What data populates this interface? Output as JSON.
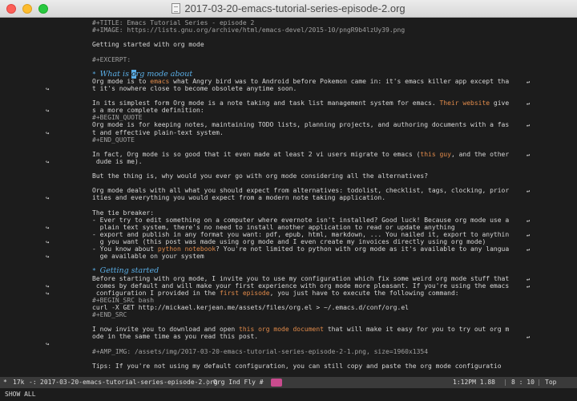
{
  "window": {
    "title": "2017-03-20-emacs-tutorial-series-episode-2.org"
  },
  "lines": [
    [
      {
        "t": "#+TITLE: Emacs Tutorial Series - episode 2",
        "c": "meta"
      }
    ],
    [
      {
        "t": "#+IMAGE: https://lists.gnu.org/archive/html/emacs-devel/2015-10/pngR9b4lzUy39.png",
        "c": "meta"
      }
    ],
    [],
    [
      {
        "t": "Getting started with org mode"
      }
    ],
    [],
    [
      {
        "t": "#+EXCERPT:",
        "c": "meta"
      }
    ],
    [],
    [
      {
        "t": "* ",
        "c": "bullet"
      },
      {
        "t": "What is ",
        "c": "heading"
      },
      {
        "t": "o",
        "c": "heading cursor"
      },
      {
        "t": "rg mode about",
        "c": "heading"
      }
    ],
    [
      {
        "t": "Org mode is to "
      },
      {
        "t": "emacs",
        "c": "link"
      },
      {
        "t": " what Angry bird was to Android before Pokemon came in: it's emacs killer app except tha"
      }
    ],
    [
      {
        "t": "t it's nowhere close to become obsolete anytime soon."
      }
    ],
    [],
    [
      {
        "t": "In its simplest form Org mode is a note taking and task list management system for emacs. "
      },
      {
        "t": "Their website",
        "c": "link"
      },
      {
        "t": " give"
      }
    ],
    [
      {
        "t": "s a more complete definition:"
      }
    ],
    [
      {
        "t": "#+BEGIN_QUOTE",
        "c": "meta"
      }
    ],
    [
      {
        "t": "Org mode is for keeping notes, maintaining TODO lists, planning projects, and authoring documents with a fas"
      }
    ],
    [
      {
        "t": "t and effective plain-text system."
      }
    ],
    [
      {
        "t": "#+END_QUOTE",
        "c": "meta"
      }
    ],
    [],
    [
      {
        "t": "In fact, Org mode is so good that it even made at least 2 vi users migrate to emacs ("
      },
      {
        "t": "this guy",
        "c": "link"
      },
      {
        "t": ", and the other"
      }
    ],
    [
      {
        "t": " dude is me)."
      }
    ],
    [],
    [
      {
        "t": "But the thing is, why would you ever go with org mode considering all the alternatives?"
      }
    ],
    [],
    [
      {
        "t": "Org mode deals with all what you should expect from alternatives: todolist, checklist, tags, clocking, prior"
      }
    ],
    [
      {
        "t": "ities and everything you would expect from a modern note taking application."
      }
    ],
    [],
    [
      {
        "t": "The tie breaker:"
      }
    ],
    [
      {
        "t": "- Ever try to edit something on a computer where evernote isn't installed? Good luck! Because org mode use a"
      }
    ],
    [
      {
        "t": "  plain text system, there's no need to install another application to read or update anything"
      }
    ],
    [
      {
        "t": "- export and publish in any format you want: pdf, epub, html, markdown, ... You nailed it, export to anythin"
      }
    ],
    [
      {
        "t": "  g you want (this post was made using org mode and I even create my invoices directly using org mode)"
      }
    ],
    [
      {
        "t": "- You know about "
      },
      {
        "t": "python notebook",
        "c": "link"
      },
      {
        "t": "? You're not limited to python with org mode as it's available to any langua"
      }
    ],
    [
      {
        "t": "  ge available on your system"
      }
    ],
    [],
    [
      {
        "t": "* ",
        "c": "bullet"
      },
      {
        "t": "Getting started",
        "c": "heading"
      }
    ],
    [
      {
        "t": "Before starting with org mode, I invite you to use my configuration which fix some weird org mode stuff that"
      }
    ],
    [
      {
        "t": " comes by default and will make your first experience with org mode more pleasant. If you're using the emacs"
      }
    ],
    [
      {
        "t": " configuration I provided in the "
      },
      {
        "t": "first episode",
        "c": "link"
      },
      {
        "t": ", you just have to execute the following command:"
      }
    ],
    [
      {
        "t": "#+BEGIN_SRC bash",
        "c": "meta"
      }
    ],
    [
      {
        "t": "curl -X GET http://mickael.kerjean.me/assets/files/org.el > ~/.emacs.d/conf/org.el"
      }
    ],
    [
      {
        "t": "#+END_SRC",
        "c": "meta"
      }
    ],
    [],
    [
      {
        "t": "I now invite you to download and open "
      },
      {
        "t": "this org mode document",
        "c": "link"
      },
      {
        "t": " that will make it easy for you to try out org m"
      }
    ],
    [
      {
        "t": "ode in the same time as you read this post."
      }
    ],
    [],
    [
      {
        "t": "#+AMP_IMG: /assets/img/2017-03-20-emacs-tutorial-series-episode-2-1.png, size=1960x1354",
        "c": "meta"
      }
    ],
    [],
    [
      {
        "t": "Tips: If you're not using my default configuration, you can still copy and paste the org mode configuratio"
      }
    ]
  ],
  "wrap_markers": [
    8,
    11,
    14,
    18,
    23,
    27,
    29,
    31,
    35,
    36,
    43
  ],
  "cont_markers": [
    9,
    12,
    15,
    19,
    24,
    28,
    30,
    32,
    36,
    37,
    44
  ],
  "modeline": {
    "state": "*",
    "size": "17k",
    "sep1": "-:",
    "buffer_name": "2017-03-20-emacs-tutorial-series-episode-2.org",
    "modes": "Org Ind Fly #",
    "time": "1:12PM 1.88",
    "position": "8 : 10",
    "scroll": "Top"
  },
  "minibuffer": {
    "text": "SHOW ALL"
  },
  "colors": {
    "background": "#1c1c1c",
    "heading": "#5aaee6",
    "link": "#e08a4a",
    "meta": "#a0a0a0",
    "modeline": "#3a3a3a"
  }
}
